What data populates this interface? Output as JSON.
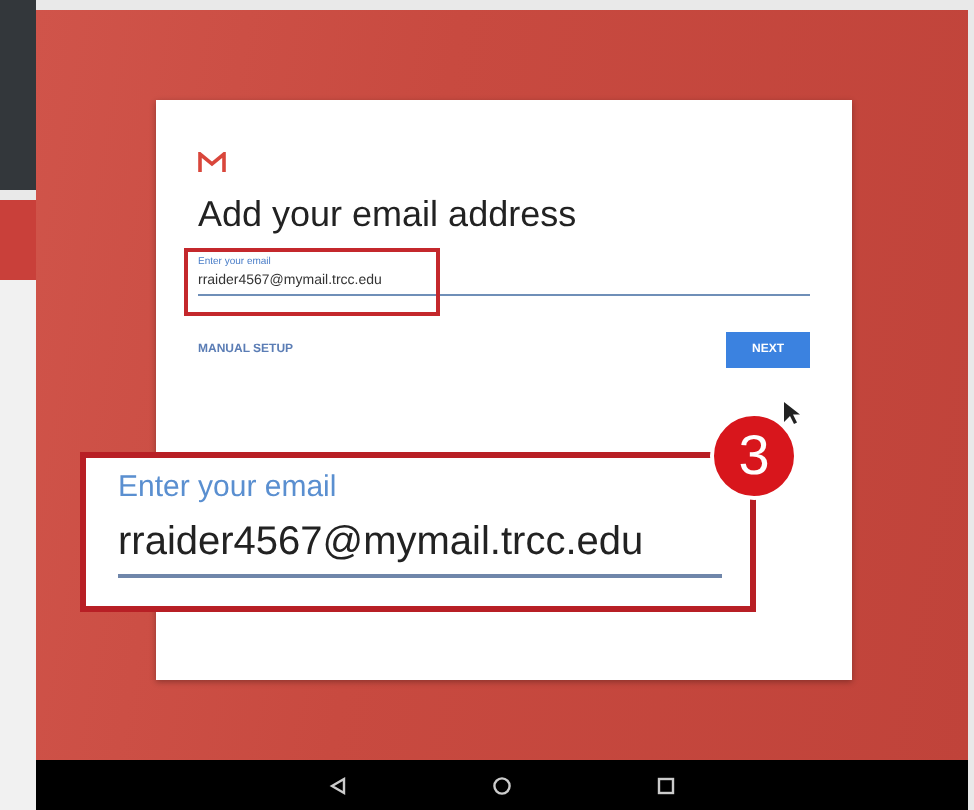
{
  "card": {
    "title": "Add your email address",
    "field": {
      "label": "Enter your email",
      "value": "rraider4567@mymail.trcc.edu"
    },
    "manual_setup": "MANUAL SETUP",
    "next_button": "NEXT"
  },
  "callout": {
    "label": "Enter your email",
    "value": "rraider4567@mymail.trcc.edu",
    "step": "3"
  }
}
